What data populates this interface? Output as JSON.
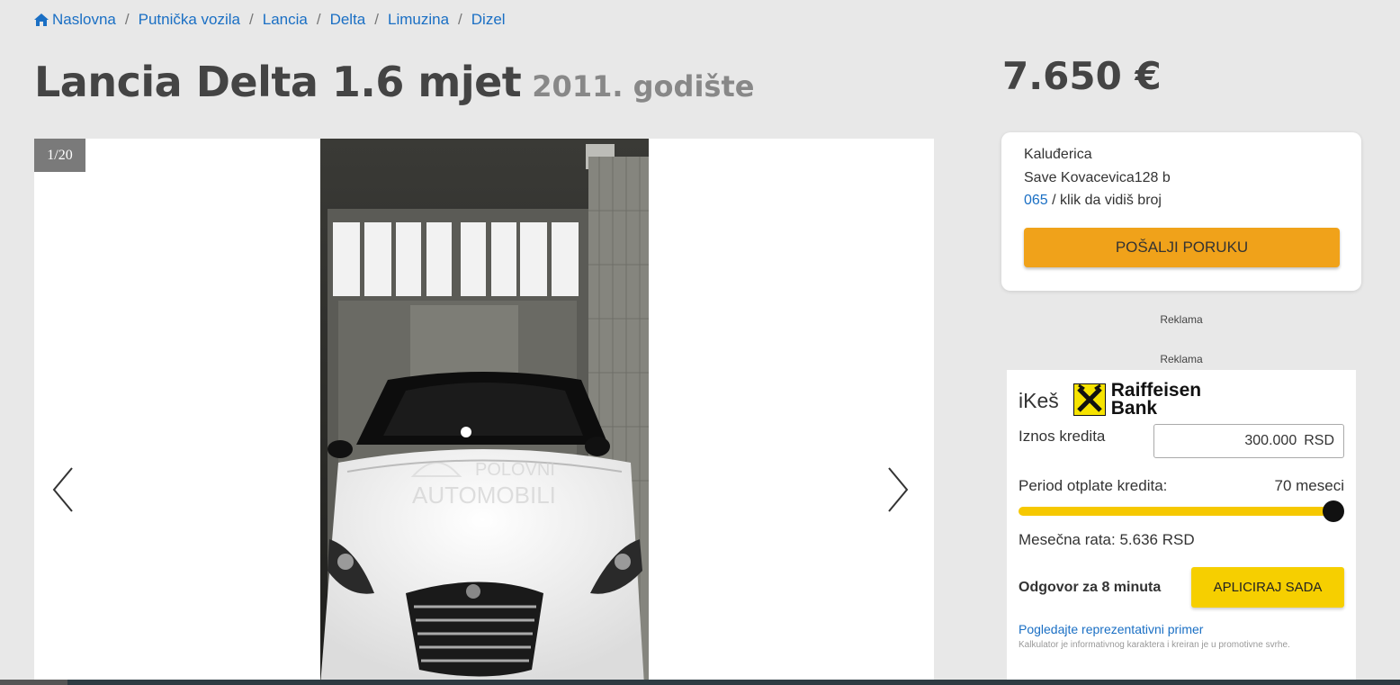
{
  "breadcrumb": [
    {
      "label": "Naslovna"
    },
    {
      "label": "Putnička vozila"
    },
    {
      "label": "Lancia"
    },
    {
      "label": "Delta"
    },
    {
      "label": "Limuzina"
    },
    {
      "label": "Dizel"
    }
  ],
  "title": "Lancia Delta 1.6 mjet",
  "year": "2011.",
  "year_suffix": "godište",
  "price": "7.650 €",
  "gallery": {
    "counter": "1/20",
    "watermark_line1": "POLOVNI",
    "watermark_line2": "AUTOMOBILI"
  },
  "contact": {
    "location": "Kaluđerica",
    "address": "Save Kovacevica128 b",
    "phone_prefix": "065",
    "phone_hint": "/ klik da vidiš broj",
    "send_label": "POŠALJI PORUKU"
  },
  "ads": {
    "label1": "Reklama",
    "label2": "Reklama"
  },
  "loan": {
    "product": "iKeš",
    "bank_line1": "Raiffeisen",
    "bank_line2": "Bank",
    "amount_label": "Iznos kredita",
    "amount_value": "300.000",
    "amount_unit": "RSD",
    "period_label": "Period otplate kredita:",
    "period_value": "70 meseci",
    "period_fraction": 1.0,
    "monthly_rate": "Mesečna rata: 5.636 RSD",
    "response_text": "Odgovor za 8 minuta",
    "apply_label": "APLICIRAJ SADA",
    "example_link": "Pogledajte reprezentativni primer",
    "disclaimer": "Kalkulator je informativnog karaktera i kreiran je u promotivne svrhe."
  },
  "colors": {
    "link": "#1a6fc4",
    "send_button": "#f0a21a",
    "apply_button": "#f6cf00",
    "slider": "#f6c800",
    "background": "#e8e8e8"
  }
}
